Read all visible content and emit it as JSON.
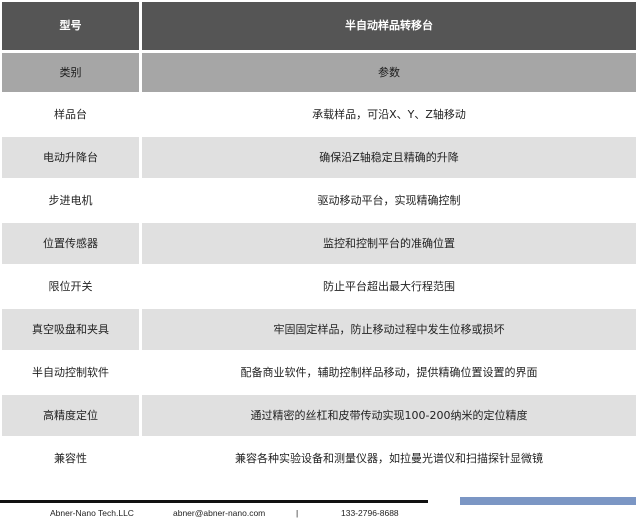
{
  "header": {
    "col1": "型号",
    "col2": "半自动样品转移台"
  },
  "subheader": {
    "col1": "类别",
    "col2": "参数"
  },
  "rows": [
    {
      "name": "样品台",
      "value": "承载样品，可沿X、Y、Z轴移动"
    },
    {
      "name": "电动升降台",
      "value": "确保沿Z轴稳定且精确的升降"
    },
    {
      "name": "步进电机",
      "value": "驱动移动平台，实现精确控制"
    },
    {
      "name": "位置传感器",
      "value": "监控和控制平台的准确位置"
    },
    {
      "name": "限位开关",
      "value": "防止平台超出最大行程范围"
    },
    {
      "name": "真空吸盘和夹具",
      "value": "牢固固定样品，防止移动过程中发生位移或损坏"
    },
    {
      "name": "半自动控制软件",
      "value": "配备商业软件，辅助控制样品移动，提供精确位置设置的界面"
    },
    {
      "name": "高精度定位",
      "value": "通过精密的丝杠和皮带传动实现100-200纳米的定位精度"
    },
    {
      "name": "兼容性",
      "value": "兼容各种实验设备和测量仪器，如拉曼光谱仪和扫描探针显微镜"
    }
  ],
  "footer": {
    "company": "Abner-Nano Tech.LLC",
    "email": "abner@abner-nano.com",
    "separator": "|",
    "phone": "133-2796-8688"
  },
  "colors": {
    "header_bg": "#555555",
    "subheader_bg": "#a6a6a6",
    "alt_row_bg": "#e0e0e0",
    "footer_accent": "#7b96c4"
  }
}
